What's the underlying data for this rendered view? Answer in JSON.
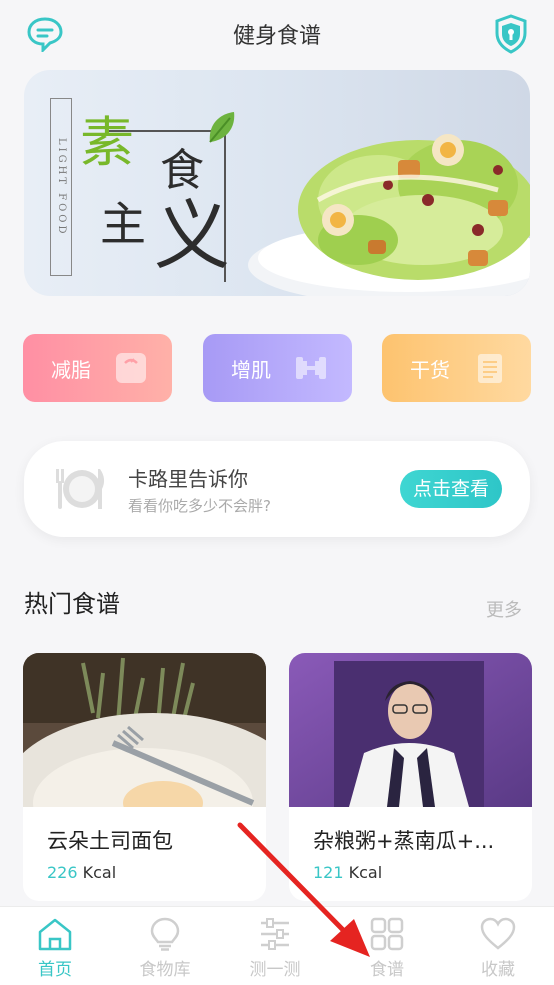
{
  "header": {
    "title": "健身食谱",
    "left_icon": "chat-bubble-icon",
    "right_icon": "shield-icon",
    "accent": "#39c6c6"
  },
  "banner": {
    "vertical_text": "LIGHT FOOD",
    "zi1": "素",
    "zi2": "食",
    "zi3": "主",
    "zi4": "义"
  },
  "categories": [
    {
      "label": "减脂",
      "icon": "scale-icon",
      "color": "#ff9aa8"
    },
    {
      "label": "增肌",
      "icon": "dumbbell-icon",
      "color": "#b0a5f8"
    },
    {
      "label": "干货",
      "icon": "notepad-icon",
      "color": "#fdc97e"
    }
  ],
  "calorie_card": {
    "title": "卡路里告诉你",
    "subtitle": "看看你吃多少不会胖?",
    "button": "点击查看",
    "icon": "plate-cutlery-icon"
  },
  "hot_section": {
    "title": "热门食谱",
    "more": "更多"
  },
  "recipes": [
    {
      "name": "云朵土司面包",
      "kcal": "226",
      "unit": "Kcal"
    },
    {
      "name": "杂粮粥+蒸南瓜+...",
      "kcal": "121",
      "unit": "Kcal"
    }
  ],
  "nav": [
    {
      "label": "首页",
      "icon": "home-icon",
      "active": true
    },
    {
      "label": "食物库",
      "icon": "lightbulb-icon",
      "active": false
    },
    {
      "label": "测一测",
      "icon": "sliders-icon",
      "active": false
    },
    {
      "label": "食谱",
      "icon": "grid-icon",
      "active": false
    },
    {
      "label": "收藏",
      "icon": "heart-icon",
      "active": false
    }
  ]
}
